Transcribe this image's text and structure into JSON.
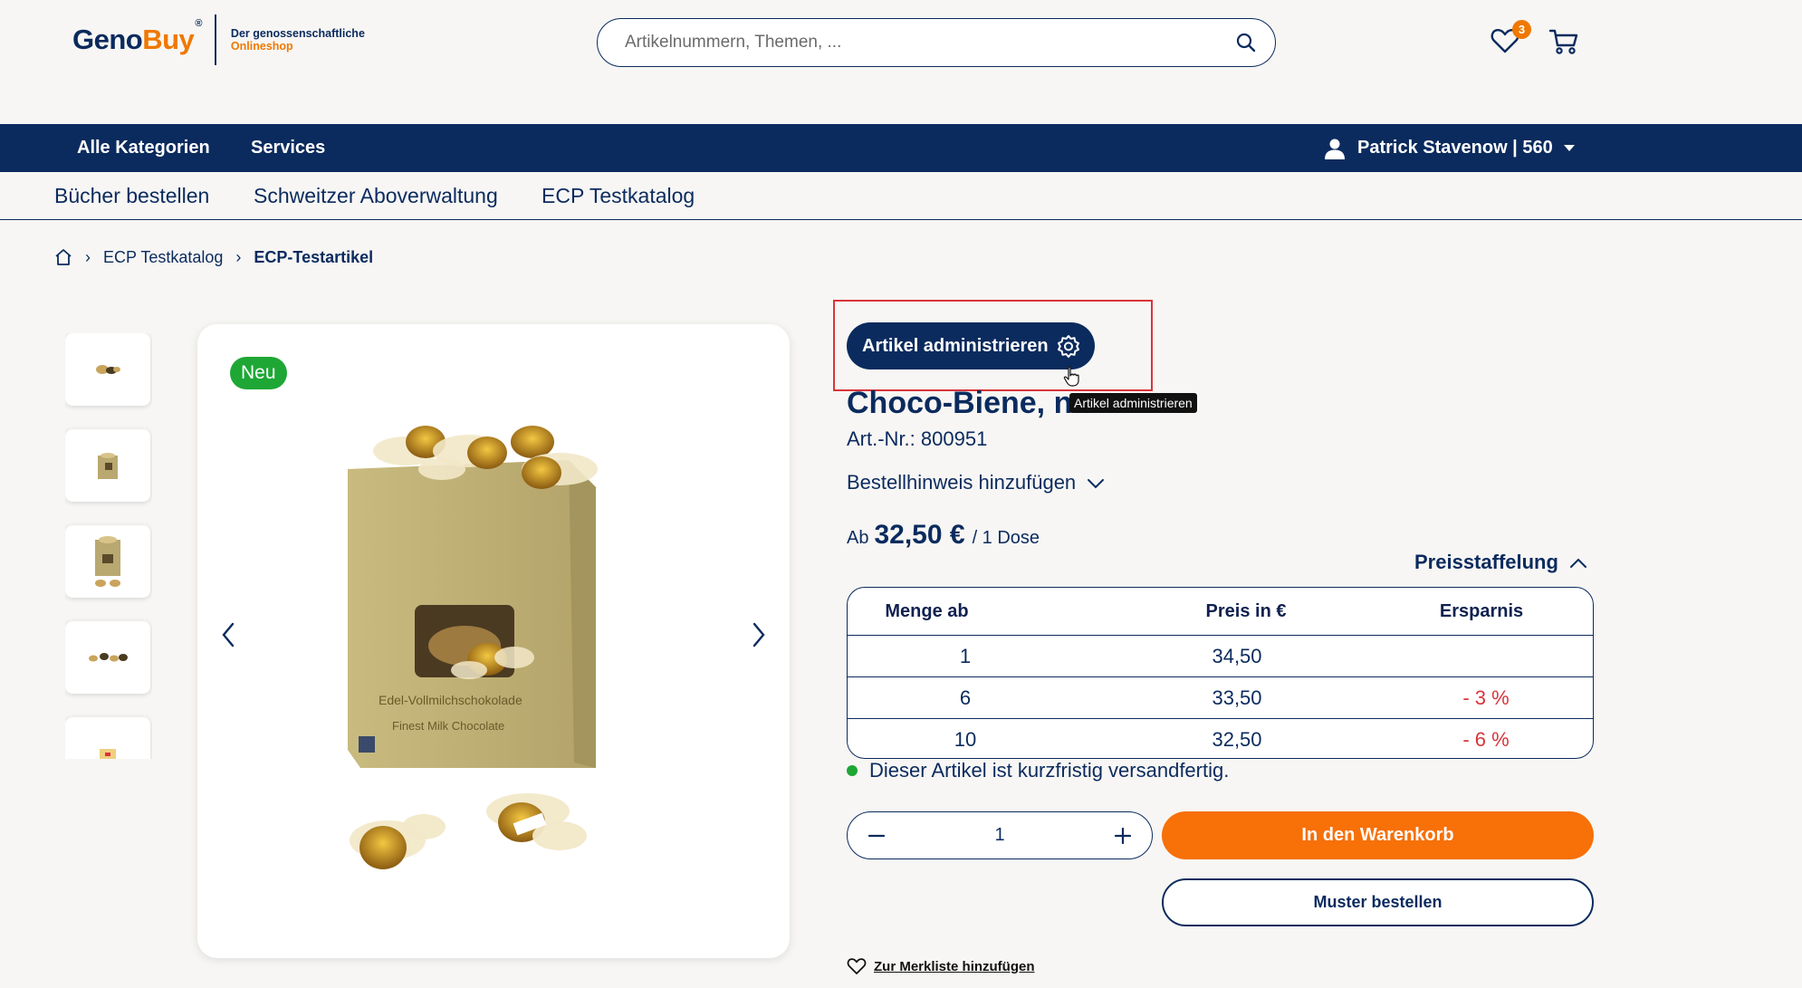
{
  "header": {
    "logo": {
      "part1": "Geno",
      "part2": "Buy",
      "reg": "®",
      "tagline1": "Der genossenschaftliche",
      "tagline2": "Onlineshop"
    },
    "search": {
      "placeholder": "Artikelnummern, Themen, ...",
      "value": ""
    },
    "wishlist_count": "3",
    "icons": {
      "search": "search-icon",
      "wishlist": "heart-icon",
      "cart": "cart-icon"
    }
  },
  "nav": {
    "items": [
      "Alle Kategorien",
      "Services"
    ],
    "user": "Patrick Stavenow | 560"
  },
  "subnav": {
    "items": [
      "Bücher bestellen",
      "Schweitzer Aboverwaltung",
      "ECP Testkatalog"
    ]
  },
  "breadcrumb": {
    "home": "home-icon",
    "items": [
      "ECP Testkatalog",
      "ECP-Testartikel"
    ]
  },
  "product": {
    "badge": "Neu",
    "admin_button": "Artikel administrieren",
    "admin_tooltip": "Artikel administrieren",
    "title": "Choco-Biene, n",
    "article_number": "Art.-Nr.: 800951",
    "order_note": "Bestellhinweis hinzufügen",
    "price_prefix": "Ab",
    "price": "32,50 €",
    "price_unit": "/ 1 Dose",
    "tier_toggle": "Preisstaffelung",
    "tier_table": {
      "headers": [
        "Menge ab",
        "Preis in €",
        "Ersparnis"
      ],
      "rows": [
        [
          "1",
          "34,50",
          ""
        ],
        [
          "6",
          "33,50",
          "- 3 %"
        ],
        [
          "10",
          "32,50",
          "- 6 %"
        ]
      ]
    },
    "availability": "Dieser Artikel ist kurzfristig versandfertig.",
    "quantity": "1",
    "add_to_cart": "In den Warenkorb",
    "order_sample": "Muster bestellen",
    "add_to_wishlist": "Zur Merkliste hinzufügen",
    "image_texts": {
      "line1": "Edel-Vollmilchschokolade",
      "line2": "Finest Milk Chocolate"
    }
  },
  "colors": {
    "navy": "#0b2b5e",
    "orange": "#f77008",
    "green": "#1ea735",
    "red": "#d9343a",
    "background": "#f7f6f4"
  }
}
